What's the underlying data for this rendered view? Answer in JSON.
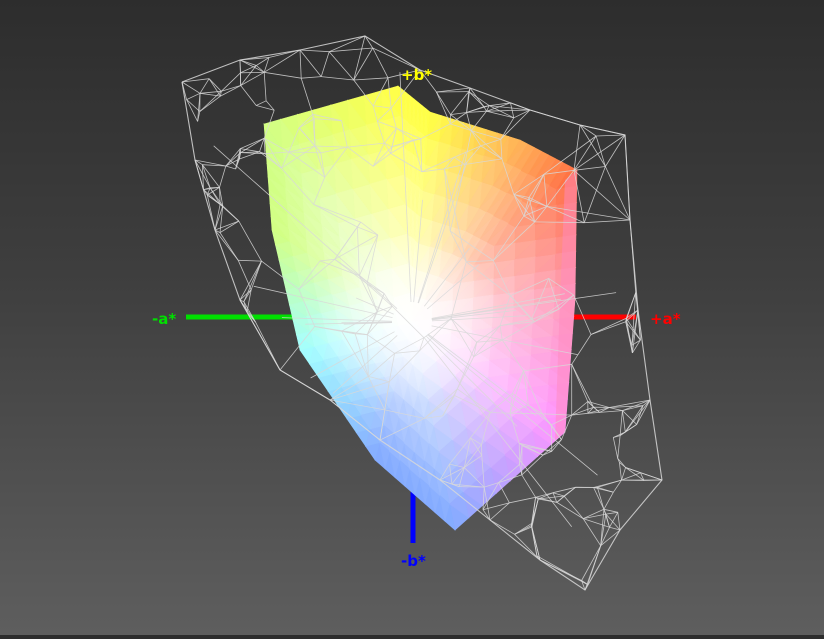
{
  "axes": {
    "plus_a": {
      "label": "+a*",
      "color": "#ff0000"
    },
    "minus_a": {
      "label": "-a*",
      "color": "#00e000"
    },
    "plus_b": {
      "label": "+b*",
      "color": "#ffff00"
    },
    "minus_b": {
      "label": "-b*",
      "color": "#0000ff"
    }
  },
  "style": {
    "background_top": "#2d2d2d",
    "background_bottom": "#5e5e5e",
    "wireframe_color": "#d8d8d8"
  },
  "solid_colors": {
    "white": "#ffffff",
    "yellow": "#ffff40",
    "red_orange": "#ff6a3a",
    "magenta": "#ff90ff",
    "blue": "#80a8ff",
    "cyan": "#a0ffff",
    "green": "#d0ff80",
    "orange": "#ffb050",
    "pink": "#ff9ab8"
  }
}
